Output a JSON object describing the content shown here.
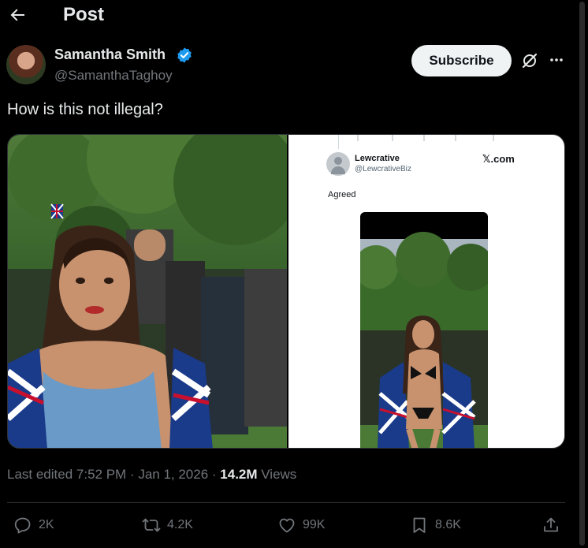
{
  "header": {
    "title": "Post"
  },
  "author": {
    "name": "Samantha Smith",
    "handle": "@SamanthaTaghoy"
  },
  "subscribe_label": "Subscribe",
  "post": {
    "text": "How is this not illegal?"
  },
  "embedded_screenshot": {
    "user_name": "Lewcrative",
    "user_handle": "@LewcrativeBiz",
    "site": "𝕏.com",
    "reply_text": "Agreed"
  },
  "meta": {
    "edited": "Last edited 7:52 PM · Jan 1, 2026 · ",
    "views_count": "14.2M",
    "views_label": " Views"
  },
  "actions": {
    "replies": "2K",
    "reposts": "4.2K",
    "likes": "99K",
    "bookmarks": "8.6K"
  },
  "colors": {
    "background": "#000000",
    "text_primary": "#e7e9ea",
    "text_secondary": "#71767b",
    "verified": "#1d9bf0",
    "divider": "#2f3336"
  }
}
